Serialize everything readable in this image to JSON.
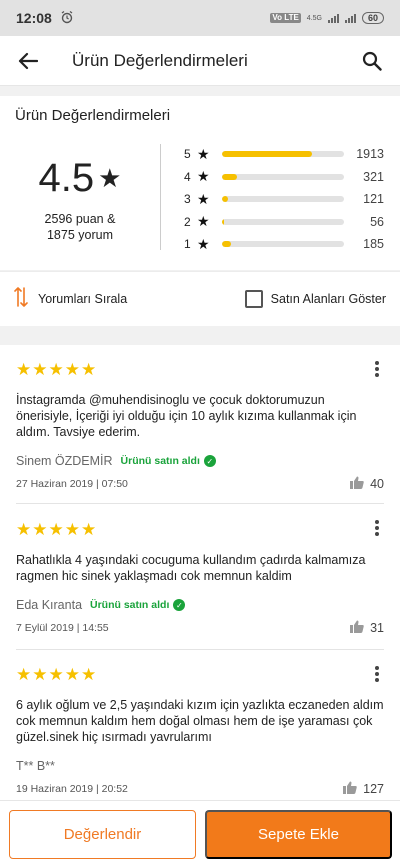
{
  "status_bar": {
    "time": "12:08",
    "alarm_icon": "alarm-icon",
    "volte": "Vo LTE",
    "network": "4.5G",
    "battery": "60"
  },
  "app_bar": {
    "title": "Ürün Değerlendirmeleri",
    "back_icon": "arrow-left-icon",
    "search_icon": "search-icon"
  },
  "summary": {
    "section_title": "Ürün Değerlendirmeleri",
    "average": "4.5",
    "counts_line1": "2596 puan &",
    "counts_line2": "1875 yorum",
    "distribution": [
      {
        "stars": "5",
        "count": "1913",
        "fraction": 0.74
      },
      {
        "stars": "4",
        "count": "321",
        "fraction": 0.12
      },
      {
        "stars": "3",
        "count": "121",
        "fraction": 0.05
      },
      {
        "stars": "2",
        "count": "56",
        "fraction": 0.02
      },
      {
        "stars": "1",
        "count": "185",
        "fraction": 0.07
      }
    ],
    "accent_color": "#f6c000"
  },
  "controls": {
    "sort_label": "Yorumları Sırala",
    "filter_label": "Satın Alanları Göster",
    "filter_checked": false
  },
  "reviews": [
    {
      "rating": 5,
      "text": "İnstagramda @muhendisinoglu ve çocuk doktorumuzun önerisiyle, İçeriği iyi olduğu için 10 aylık kızıma kullanmak için aldım. Tavsiye ederim.",
      "author": "Sinem ÖZDEMİR",
      "verified": "Ürünü satın aldı",
      "date": "27 Haziran 2019 | 07:50",
      "likes": "40"
    },
    {
      "rating": 5,
      "text": "Rahatlıkla 4 yaşındaki cocuguma kullandım çadırda kalmamıza ragmen hic sinek yaklaşmadı cok memnun kaldim",
      "author": "Eda Kıranta",
      "verified": "Ürünü satın aldı",
      "date": "7 Eylül 2019 | 14:55",
      "likes": "31"
    },
    {
      "rating": 5,
      "text": "6 aylık oğlum ve 2,5 yaşındaki kızım için yazlıkta eczaneden aldım cok memnun kaldım hem doğal olması hem de işe yaraması çok güzel.sinek hiç ısırmadı yavrularımı",
      "author": "T** B**",
      "verified": "",
      "date": "19 Haziran 2019 | 20:52",
      "likes": "127"
    }
  ],
  "bottom_bar": {
    "rate_label": "Değerlendir",
    "cart_label": "Sepete Ekle",
    "brand_color": "#f27a1a"
  }
}
